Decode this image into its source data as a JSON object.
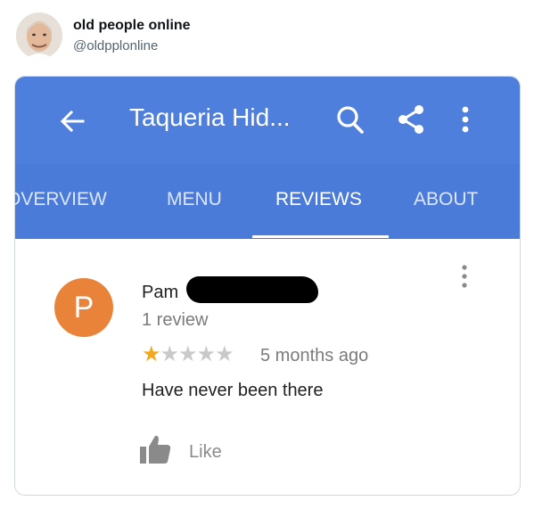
{
  "tweet": {
    "display_name": "old people online",
    "handle": "@oldpplonline"
  },
  "app": {
    "title": "Taqueria Hid...",
    "colors": {
      "appbar": "#4f7fdc",
      "tabs": "#4b7bd8",
      "accent_star": "#f2a81d",
      "avatar_bg": "#e9833a"
    },
    "icons": [
      "back-arrow-icon",
      "search-icon",
      "share-icon",
      "more-vert-icon"
    ],
    "tabs": [
      {
        "label": "OVERVIEW",
        "active": false
      },
      {
        "label": "MENU",
        "active": false
      },
      {
        "label": "REVIEWS",
        "active": true
      },
      {
        "label": "ABOUT",
        "active": false
      }
    ]
  },
  "review": {
    "avatar_letter": "P",
    "reviewer_name": "Pam",
    "review_count": "1 review",
    "rating": 1,
    "rating_max": 5,
    "time": "5 months ago",
    "text": "Have never been there",
    "like_label": "Like"
  }
}
